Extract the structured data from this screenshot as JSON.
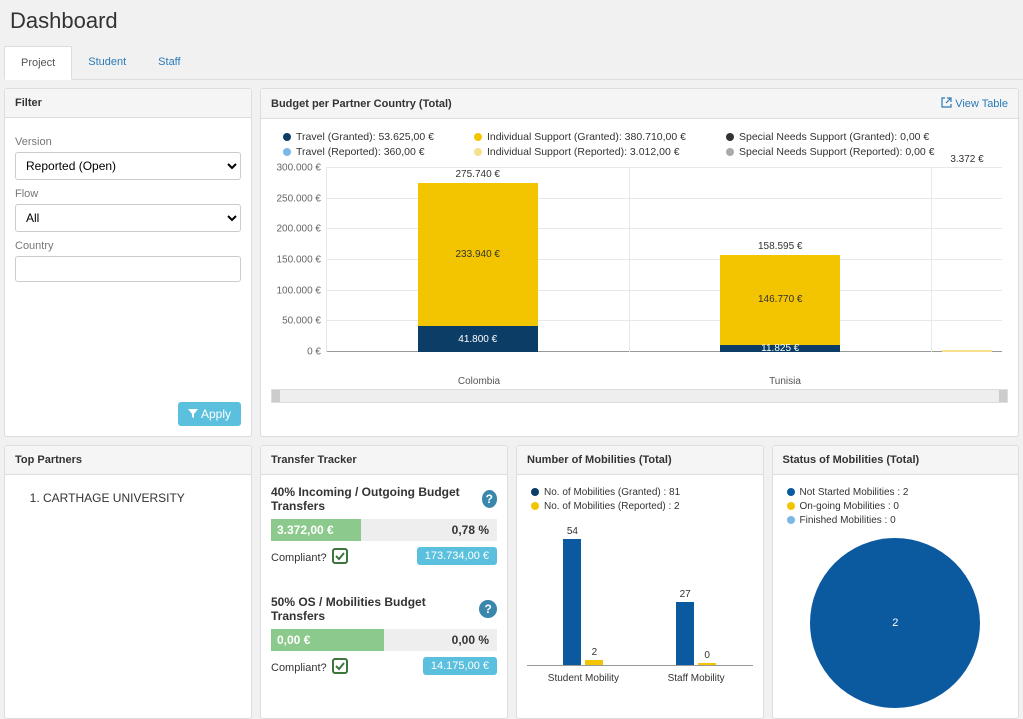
{
  "page_title": "Dashboard",
  "tabs": {
    "project": "Project",
    "student": "Student",
    "staff": "Staff"
  },
  "filter": {
    "header": "Filter",
    "version_label": "Version",
    "version_value": "Reported   (Open)",
    "flow_label": "Flow",
    "flow_value": "All",
    "country_label": "Country",
    "country_value": "",
    "apply_label": "Apply"
  },
  "budget": {
    "header": "Budget per Partner Country (Total)",
    "view_table": "View Table",
    "legend": {
      "travel_g": "Travel (Granted): 53.625,00 €",
      "travel_r": "Travel (Reported): 360,00 €",
      "individual_g": "Individual Support (Granted): 380.710,00 €",
      "individual_r": "Individual Support (Reported): 3.012,00 €",
      "special_g": "Special Needs Support (Granted): 0,00 €",
      "special_r": "Special Needs Support (Reported): 0,00 €"
    }
  },
  "chart_data": {
    "type": "bar",
    "ylabel": "€",
    "ylim": [
      0,
      300000
    ],
    "yticks": [
      "0 €",
      "50.000 €",
      "100.000 €",
      "150.000 €",
      "200.000 €",
      "250.000 €",
      "300.000 €"
    ],
    "categories": [
      "Colombia",
      "Tunisia"
    ],
    "segments": [
      {
        "name": "Travel (Granted)",
        "color": "#0b3d66"
      },
      {
        "name": "Individual Support (Granted)",
        "color": "#f2c500"
      }
    ],
    "bars": [
      {
        "category": "Colombia",
        "total": "275.740 €",
        "total_val": 275740,
        "parts": [
          {
            "label": "41.800 €",
            "value": 41800,
            "color": "#0b3d66",
            "text": "light"
          },
          {
            "label": "233.940 €",
            "value": 233940,
            "color": "#f2c500",
            "text": "dark"
          }
        ]
      },
      {
        "category": "Tunisia",
        "total": "158.595 €",
        "total_val": 158595,
        "parts": [
          {
            "label": "11.825 €",
            "value": 11825,
            "color": "#0b3d66",
            "text": "light"
          },
          {
            "label": "146.770 €",
            "value": 146770,
            "color": "#f2c500",
            "text": "dark"
          }
        ]
      }
    ],
    "third_bar_label": "3.372 €",
    "third_bar_val": 3372
  },
  "top_partners": {
    "header": "Top Partners",
    "items": [
      "CARTHAGE UNIVERSITY"
    ]
  },
  "transfer": {
    "header": "Transfer Tracker",
    "t1_title": "40% Incoming / Outgoing Budget Transfers",
    "t1_amount": "3.372,00 €",
    "t1_pct": "0,78 %",
    "t1_fill_pct": 40,
    "t1_compliant": "Compliant?",
    "t1_badge": "173.734,00 €",
    "t2_title": "50% OS / Mobilities Budget Transfers",
    "t2_amount": "0,00 €",
    "t2_pct": "0,00 %",
    "t2_fill_pct": 50,
    "t2_compliant": "Compliant?",
    "t2_badge": "14.175,00 €"
  },
  "mobilities": {
    "header": "Number of Mobilities (Total)",
    "legend_g": "No. of Mobilities (Granted) : 81",
    "legend_r": "No. of Mobilities (Reported) : 2",
    "chart": {
      "type": "bar",
      "categories": [
        "Student Mobility",
        "Staff Mobility"
      ],
      "series": [
        {
          "name": "Granted",
          "color": "#0b5aa0",
          "values": [
            54,
            27
          ]
        },
        {
          "name": "Reported",
          "color": "#f2c500",
          "values": [
            2,
            0
          ]
        }
      ],
      "max": 60
    }
  },
  "status": {
    "header": "Status of Mobilities (Total)",
    "legend_ns": "Not Started Mobilities : 2",
    "legend_og": "On-going Mobilities : 0",
    "legend_fn": "Finished Mobilities : 0",
    "pie_label": "2",
    "pie_color": "#0b5aa0"
  }
}
